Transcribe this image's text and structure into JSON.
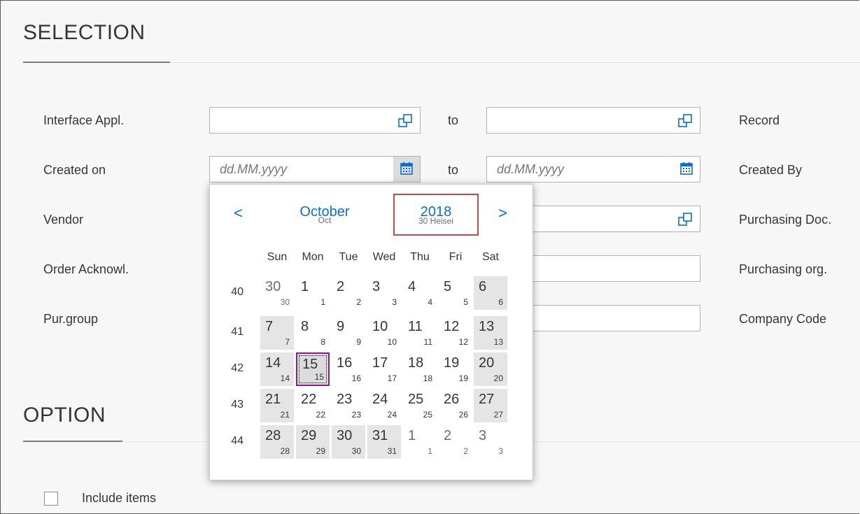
{
  "selection": {
    "title": "SELECTION",
    "fields": {
      "interface_appl": {
        "label": "Interface Appl.",
        "to": "to"
      },
      "created_on": {
        "label": "Created on",
        "placeholder_from": "dd.MM.yyyy",
        "to": "to",
        "placeholder_to": "dd.MM.yyyy"
      },
      "vendor": {
        "label": "Vendor"
      },
      "order_acknowl": {
        "label": "Order Acknowl."
      },
      "pur_group": {
        "label": "Pur.group"
      }
    },
    "right_labels": {
      "record": "Record",
      "created_by": "Created By",
      "purchasing_doc": "Purchasing Doc.",
      "purchasing_org": "Purchasing org.",
      "company_code": "Company Code"
    }
  },
  "option": {
    "title": "OPTION",
    "include_items_label": "Include items"
  },
  "calendar": {
    "prev_arrow": "<",
    "next_arrow": ">",
    "month": "October",
    "month_secondary": "Oct",
    "year": "2018",
    "year_secondary": "30 Heisei",
    "weekdays": [
      "Sun",
      "Mon",
      "Tue",
      "Wed",
      "Thu",
      "Fri",
      "Sat"
    ],
    "weeks": [
      {
        "number": "40",
        "days": [
          [
            "30",
            "30"
          ],
          [
            "1",
            "1"
          ],
          [
            "2",
            "2"
          ],
          [
            "3",
            "3"
          ],
          [
            "4",
            "4"
          ],
          [
            "5",
            "5"
          ],
          [
            "6",
            "6"
          ]
        ]
      },
      {
        "number": "41",
        "days": [
          [
            "7",
            "7"
          ],
          [
            "8",
            "8"
          ],
          [
            "9",
            "9"
          ],
          [
            "10",
            "10"
          ],
          [
            "11",
            "11"
          ],
          [
            "12",
            "12"
          ],
          [
            "13",
            "13"
          ]
        ]
      },
      {
        "number": "42",
        "days": [
          [
            "14",
            "14"
          ],
          [
            "15",
            "15"
          ],
          [
            "16",
            "16"
          ],
          [
            "17",
            "17"
          ],
          [
            "18",
            "18"
          ],
          [
            "19",
            "19"
          ],
          [
            "20",
            "20"
          ]
        ]
      },
      {
        "number": "43",
        "days": [
          [
            "21",
            "21"
          ],
          [
            "22",
            "22"
          ],
          [
            "23",
            "23"
          ],
          [
            "24",
            "24"
          ],
          [
            "25",
            "25"
          ],
          [
            "26",
            "26"
          ],
          [
            "27",
            "27"
          ]
        ]
      },
      {
        "number": "44",
        "days": [
          [
            "28",
            "28"
          ],
          [
            "29",
            "29"
          ],
          [
            "30",
            "30"
          ],
          [
            "31",
            "31"
          ],
          [
            "1",
            "1"
          ],
          [
            "2",
            "2"
          ],
          [
            "3",
            "3"
          ]
        ]
      }
    ],
    "selected_day": "15",
    "colors": {
      "accent": "#0a6ed1",
      "selection_border": "#8b1c8b",
      "highlight_box": "#c24a4a"
    }
  }
}
